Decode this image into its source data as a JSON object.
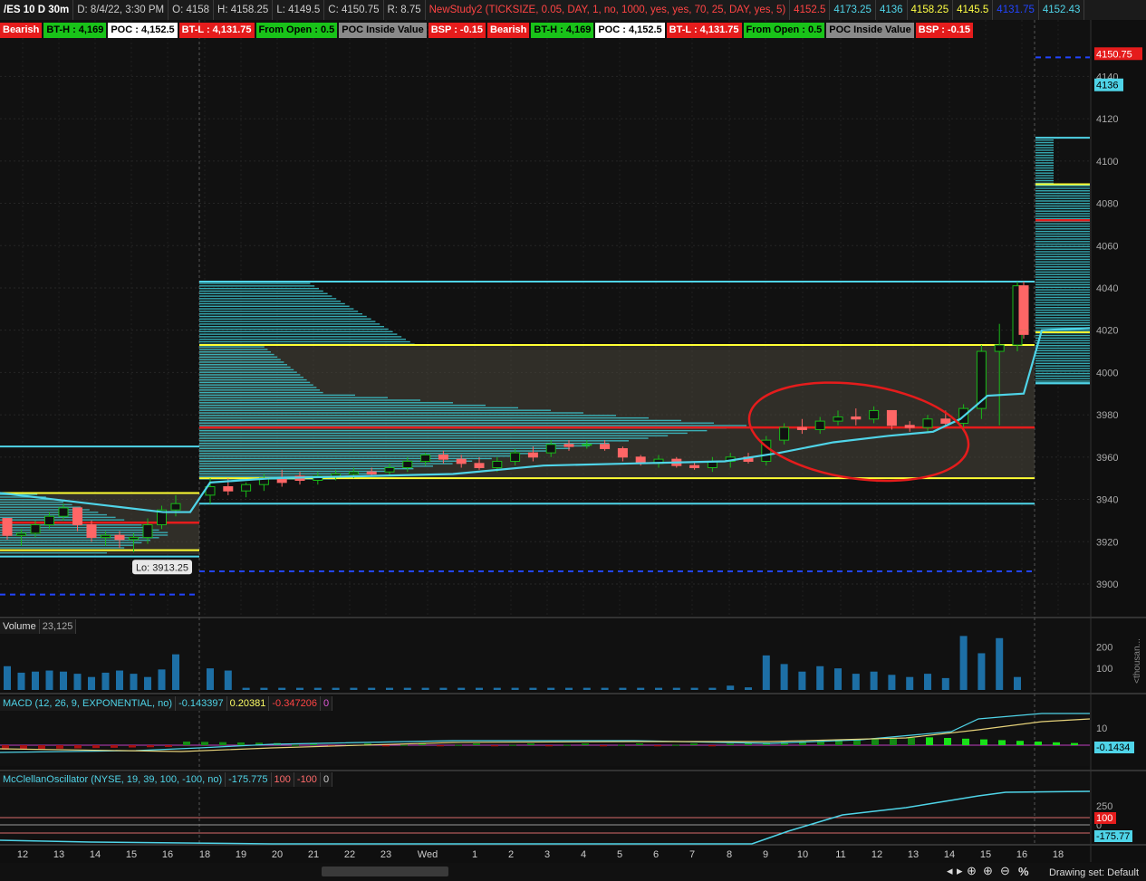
{
  "header": {
    "symbol": "/ES 10 D 30m",
    "date": "D: 8/4/22, 3:30 PM",
    "open": "O: 4158",
    "high": "H: 4158.25",
    "low": "L: 4149.5",
    "close": "C: 4150.75",
    "range": "R: 8.75",
    "study": "NewStudy2 (TICKSIZE, 0.05, DAY, 1, no, 1000, yes, yes, 70, 25, DAY, yes, 5)",
    "values": [
      "4152.5",
      "4173.25",
      "4136",
      "4158.25",
      "4145.5",
      "4131.75",
      "4152.43"
    ],
    "value_colors": [
      "#ff4444",
      "#4fd4e8",
      "#4fd4e8",
      "#ffff44",
      "#ffff44",
      "#2244ff",
      "#4fd4e8"
    ]
  },
  "labels": [
    {
      "text": "Bearish",
      "bg": "#e51c1c",
      "fg": "#ffffff"
    },
    {
      "text": "BT-H : 4,169",
      "bg": "#19c319",
      "fg": "#000000"
    },
    {
      "text": "POC : 4,152.5",
      "bg": "#ffffff",
      "fg": "#000000"
    },
    {
      "text": "BT-L : 4,131.75",
      "bg": "#e51c1c",
      "fg": "#ffffff"
    },
    {
      "text": "From Open : 0.5",
      "bg": "#19c319",
      "fg": "#000000"
    },
    {
      "text": "POC Inside Value",
      "bg": "#8a8a8a",
      "fg": "#000000"
    },
    {
      "text": "BSP : -0.15",
      "bg": "#e51c1c",
      "fg": "#ffffff"
    },
    {
      "text": "Bearish",
      "bg": "#e51c1c",
      "fg": "#ffffff"
    },
    {
      "text": "BT-H : 4,169",
      "bg": "#19c319",
      "fg": "#000000"
    },
    {
      "text": "POC : 4,152.5",
      "bg": "#ffffff",
      "fg": "#000000"
    },
    {
      "text": "BT-L : 4,131.75",
      "bg": "#e51c1c",
      "fg": "#ffffff"
    },
    {
      "text": "From Open : 0.5",
      "bg": "#19c319",
      "fg": "#000000"
    },
    {
      "text": "POC Inside Value",
      "bg": "#8a8a8a",
      "fg": "#000000"
    },
    {
      "text": "BSP : -0.15",
      "bg": "#e51c1c",
      "fg": "#ffffff"
    }
  ],
  "chart_data": {
    "type": "candlestick",
    "x_ticks": [
      "12",
      "13",
      "14",
      "15",
      "16",
      "18",
      "19",
      "20",
      "21",
      "22",
      "23",
      "Wed",
      "1",
      "2",
      "3",
      "4",
      "5",
      "6",
      "7",
      "8",
      "9",
      "10",
      "11",
      "12",
      "13",
      "14",
      "15",
      "16",
      "18"
    ],
    "price_axis": {
      "ticks": [
        3900,
        3920,
        3940,
        3960,
        3980,
        4000,
        4020,
        4040,
        4060,
        4080,
        4100,
        4120,
        4140
      ],
      "range": [
        3885,
        4165
      ]
    },
    "price_badges": [
      {
        "text": "4150.75",
        "value": 4150.75,
        "bg": "#e51c1c",
        "fg": "#ffffff"
      },
      {
        "text": "4136",
        "value": 4136,
        "bg": "#4fd4e8",
        "fg": "#000000"
      }
    ],
    "low_annotation": "Lo: 3913.25",
    "candles": [
      [
        3931,
        3931,
        3921,
        3923
      ],
      [
        3923,
        3926,
        3918,
        3924
      ],
      [
        3924,
        3930,
        3922,
        3928
      ],
      [
        3928,
        3934,
        3926,
        3932
      ],
      [
        3932,
        3938,
        3930,
        3936
      ],
      [
        3936,
        3936,
        3925,
        3928
      ],
      [
        3928,
        3930,
        3920,
        3922
      ],
      [
        3922,
        3925,
        3918,
        3923
      ],
      [
        3923,
        3925,
        3917,
        3921
      ],
      [
        3921,
        3924,
        3915,
        3922
      ],
      [
        3922,
        3931,
        3919,
        3928
      ],
      [
        3928,
        3937,
        3926,
        3935
      ],
      [
        3935,
        3942,
        3932,
        3938
      ],
      [
        3942,
        3950,
        3938,
        3946
      ],
      [
        3946,
        3950,
        3942,
        3944
      ],
      [
        3944,
        3948,
        3941,
        3947
      ],
      [
        3947,
        3952,
        3944,
        3950
      ],
      [
        3950,
        3954,
        3946,
        3948
      ],
      [
        3951,
        3953,
        3947,
        3949
      ],
      [
        3949,
        3953,
        3947,
        3951
      ],
      [
        3951,
        3954,
        3949,
        3952
      ],
      [
        3952,
        3955,
        3950,
        3953
      ],
      [
        3953,
        3955,
        3951,
        3952
      ],
      [
        3953,
        3957,
        3951,
        3955
      ],
      [
        3955,
        3960,
        3953,
        3958
      ],
      [
        3958,
        3962,
        3956,
        3961
      ],
      [
        3961,
        3963,
        3957,
        3959
      ],
      [
        3959,
        3961,
        3955,
        3957
      ],
      [
        3957,
        3960,
        3954,
        3955
      ],
      [
        3955,
        3960,
        3953,
        3958
      ],
      [
        3958,
        3964,
        3956,
        3962
      ],
      [
        3962,
        3965,
        3958,
        3960
      ],
      [
        3962,
        3968,
        3960,
        3966
      ],
      [
        3966,
        3968,
        3963,
        3965
      ],
      [
        3966,
        3968,
        3964,
        3966
      ],
      [
        3966,
        3968,
        3963,
        3964
      ],
      [
        3964,
        3965,
        3958,
        3960
      ],
      [
        3960,
        3961,
        3956,
        3957
      ],
      [
        3957,
        3961,
        3955,
        3959
      ],
      [
        3959,
        3960,
        3955,
        3956
      ],
      [
        3956,
        3958,
        3954,
        3955
      ],
      [
        3955,
        3960,
        3953,
        3958
      ],
      [
        3958,
        3962,
        3955,
        3960
      ],
      [
        3960,
        3962,
        3957,
        3958
      ],
      [
        3958,
        3970,
        3956,
        3968
      ],
      [
        3968,
        3976,
        3966,
        3974
      ],
      [
        3974,
        3978,
        3971,
        3973
      ],
      [
        3973,
        3979,
        3971,
        3977
      ],
      [
        3977,
        3982,
        3975,
        3979
      ],
      [
        3979,
        3983,
        3975,
        3978
      ],
      [
        3978,
        3984,
        3976,
        3982
      ],
      [
        3982,
        3982,
        3973,
        3975
      ],
      [
        3975,
        3977,
        3972,
        3974
      ],
      [
        3974,
        3980,
        3972,
        3978
      ],
      [
        3978,
        3982,
        3975,
        3976
      ],
      [
        3976,
        3985,
        3974,
        3983
      ],
      [
        3983,
        4013,
        3978,
        4010
      ],
      [
        4010,
        4023,
        3975,
        4013
      ],
      [
        4013,
        4043,
        4010,
        4041
      ],
      [
        4041,
        4043,
        4022,
        4024
      ],
      [
        4024,
        4024,
        4016,
        4020
      ],
      [
        4020,
        4021,
        4019,
        4020
      ],
      [
        4020,
        4022,
        4017,
        4018
      ]
    ],
    "overlay_lines": {
      "poc_red": [
        4152.5
      ],
      "value_area_high": 4013,
      "value_area_low": 3950,
      "day2_high": 4043,
      "day2_low": 3938
    },
    "volume": {
      "label": "Volume",
      "value": "23,125",
      "ticks": [
        100,
        200
      ],
      "unit_label": "<thousan...",
      "values": [
        110,
        80,
        85,
        90,
        85,
        75,
        60,
        80,
        90,
        75,
        60,
        95,
        165,
        100,
        90,
        10,
        10,
        10,
        10,
        10,
        10,
        10,
        10,
        10,
        10,
        10,
        10,
        10,
        10,
        10,
        10,
        10,
        10,
        10,
        10,
        10,
        10,
        10,
        10,
        10,
        10,
        10,
        20,
        12,
        160,
        120,
        85,
        110,
        100,
        75,
        85,
        70,
        60,
        75,
        55,
        250,
        170,
        240,
        60,
        30,
        30,
        15,
        10
      ]
    },
    "macd": {
      "label": "MACD (12, 26, 9, EXPONENTIAL, no)",
      "value": "-0.143397",
      "avg": "0.20381",
      "diff": "-0.347206",
      "zero": "0",
      "ticks": [
        10
      ],
      "badge": "-0.1434"
    },
    "mcclellan": {
      "label": "McClellanOscillator (NYSE, 19, 39, 100, -100, no)",
      "value": "-175.775",
      "upper": "100",
      "lower": "-100",
      "zero": "0",
      "ticks": [
        250,
        100,
        0
      ],
      "badge": "-175.77"
    }
  },
  "footer": {
    "drawing_set": "Drawing set: Default",
    "percent": "%"
  }
}
